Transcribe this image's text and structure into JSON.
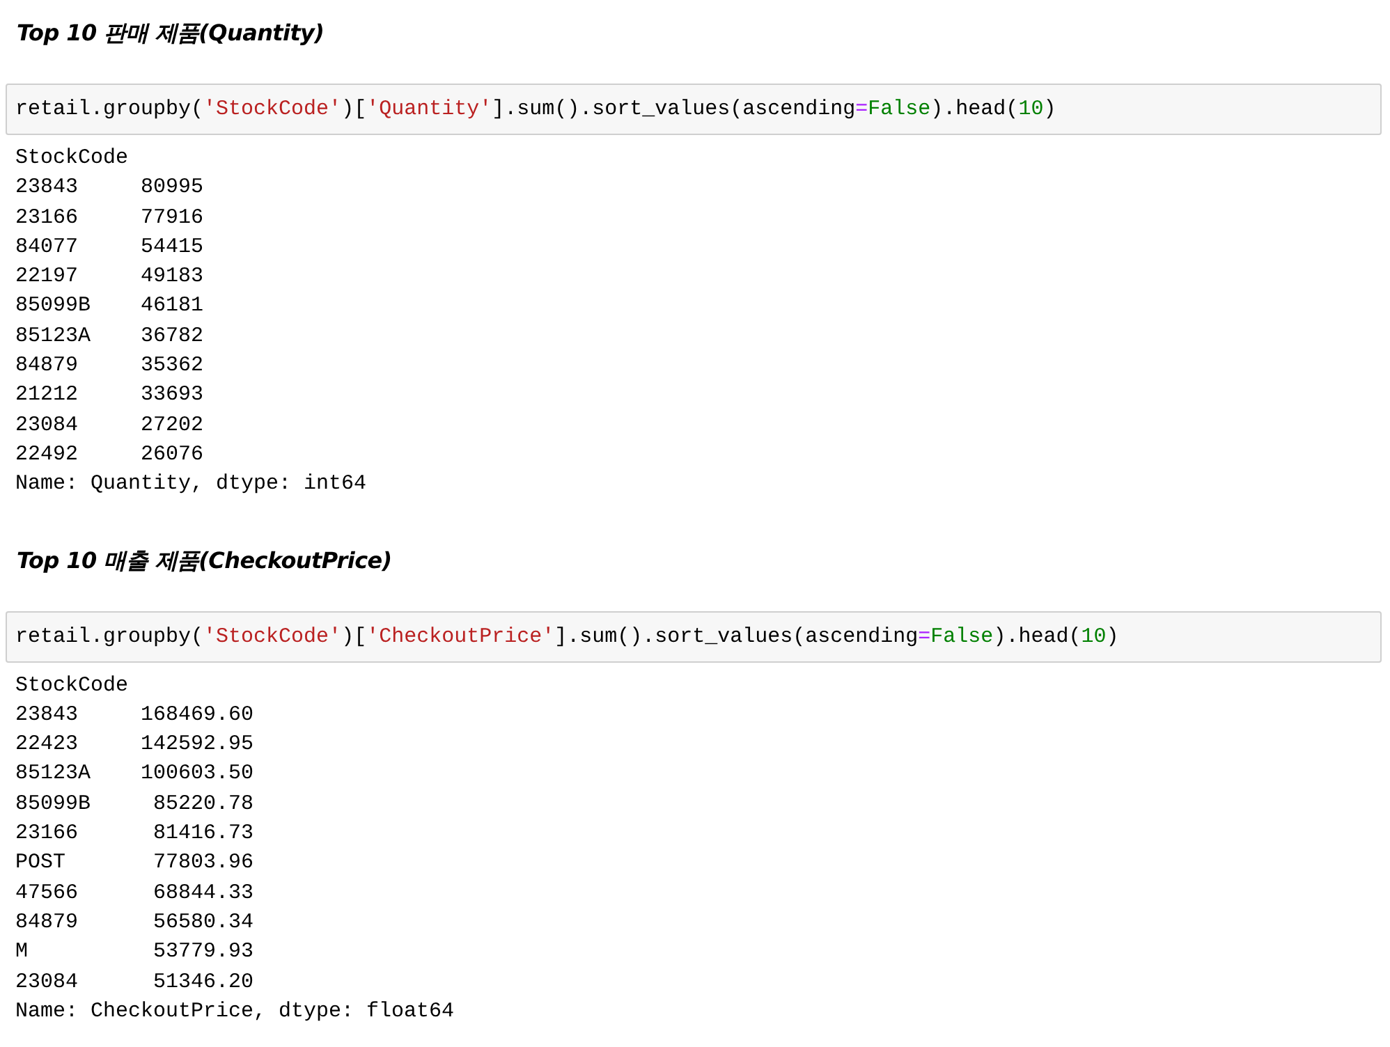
{
  "sections": [
    {
      "heading": "Top 10 판매 제품(Quantity)",
      "code": [
        {
          "kind": "plain",
          "text": "retail.groupby("
        },
        {
          "kind": "string",
          "text": "'StockCode'"
        },
        {
          "kind": "plain",
          "text": ")["
        },
        {
          "kind": "string",
          "text": "'Quantity'"
        },
        {
          "kind": "plain",
          "text": "].sum().sort_values(ascending"
        },
        {
          "kind": "operator",
          "text": "="
        },
        {
          "kind": "constant",
          "text": "False"
        },
        {
          "kind": "plain",
          "text": ").head("
        },
        {
          "kind": "number",
          "text": "10"
        },
        {
          "kind": "plain",
          "text": ")"
        }
      ],
      "output": [
        "StockCode",
        "23843     80995",
        "23166     77916",
        "84077     54415",
        "22197     49183",
        "85099B    46181",
        "85123A    36782",
        "84879     35362",
        "21212     33693",
        "23084     27202",
        "22492     26076",
        "Name: Quantity, dtype: int64"
      ]
    },
    {
      "heading": "Top 10 매출 제품(CheckoutPrice)",
      "code": [
        {
          "kind": "plain",
          "text": "retail.groupby("
        },
        {
          "kind": "string",
          "text": "'StockCode'"
        },
        {
          "kind": "plain",
          "text": ")["
        },
        {
          "kind": "string",
          "text": "'CheckoutPrice'"
        },
        {
          "kind": "plain",
          "text": "].sum().sort_values(ascending"
        },
        {
          "kind": "operator",
          "text": "="
        },
        {
          "kind": "constant",
          "text": "False"
        },
        {
          "kind": "plain",
          "text": ").head("
        },
        {
          "kind": "number",
          "text": "10"
        },
        {
          "kind": "plain",
          "text": ")"
        }
      ],
      "output": [
        "StockCode",
        "23843     168469.60",
        "22423     142592.95",
        "85123A    100603.50",
        "85099B     85220.78",
        "23166      81416.73",
        "POST       77803.96",
        "47566      68844.33",
        "84879      56580.34",
        "M          53779.93",
        "23084      51346.20",
        "Name: CheckoutPrice, dtype: float64"
      ]
    }
  ]
}
